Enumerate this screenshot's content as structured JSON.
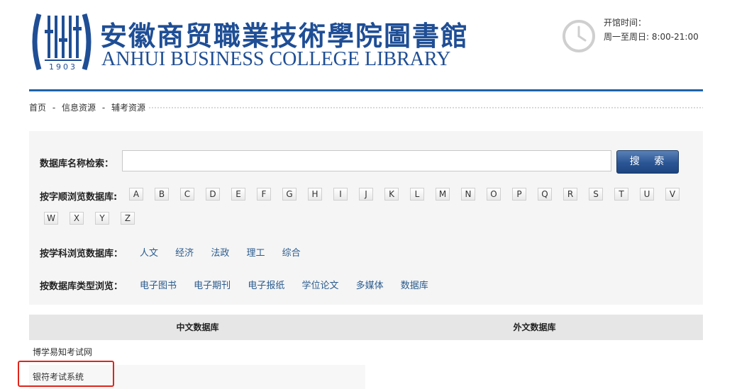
{
  "header": {
    "logo_cn": "安徽商贸職業技術學院圖書館",
    "logo_en": "ANHUI BUSINESS COLLEGE LIBRARY",
    "logo_year": "1903",
    "hours_label": "开馆时间：",
    "hours_value": "周一至周日: 8:00-21:00"
  },
  "breadcrumb": {
    "items": [
      "首页",
      "信息资源",
      "辅考资源"
    ],
    "separator": "-"
  },
  "search": {
    "label": "数据库名称检索：",
    "input_value": "",
    "button_label": "搜 索"
  },
  "alphabet": {
    "label": "按字顺浏览数据库:",
    "letters": [
      "A",
      "B",
      "C",
      "D",
      "E",
      "F",
      "G",
      "H",
      "I",
      "J",
      "K",
      "L",
      "M",
      "N",
      "O",
      "P",
      "Q",
      "R",
      "S",
      "T",
      "U",
      "V",
      "W",
      "X",
      "Y",
      "Z"
    ]
  },
  "subject": {
    "label": "按学科浏览数据库：",
    "items": [
      "人文",
      "经济",
      "法政",
      "理工",
      "综合"
    ]
  },
  "type": {
    "label": "按数据库类型浏览：",
    "items": [
      "电子图书",
      "电子期刊",
      "电子报纸",
      "学位论文",
      "多媒体",
      "数据库"
    ]
  },
  "table": {
    "headers": [
      "中文数据库",
      "外文数据库"
    ],
    "chinese_rows": [
      "博学易知考试网",
      "银符考试系统"
    ]
  },
  "colors": {
    "brand_blue": "#1f4e95",
    "rule_blue": "#1e64a8",
    "link_blue": "#2a5b8e",
    "highlight_red": "#e0251b"
  }
}
